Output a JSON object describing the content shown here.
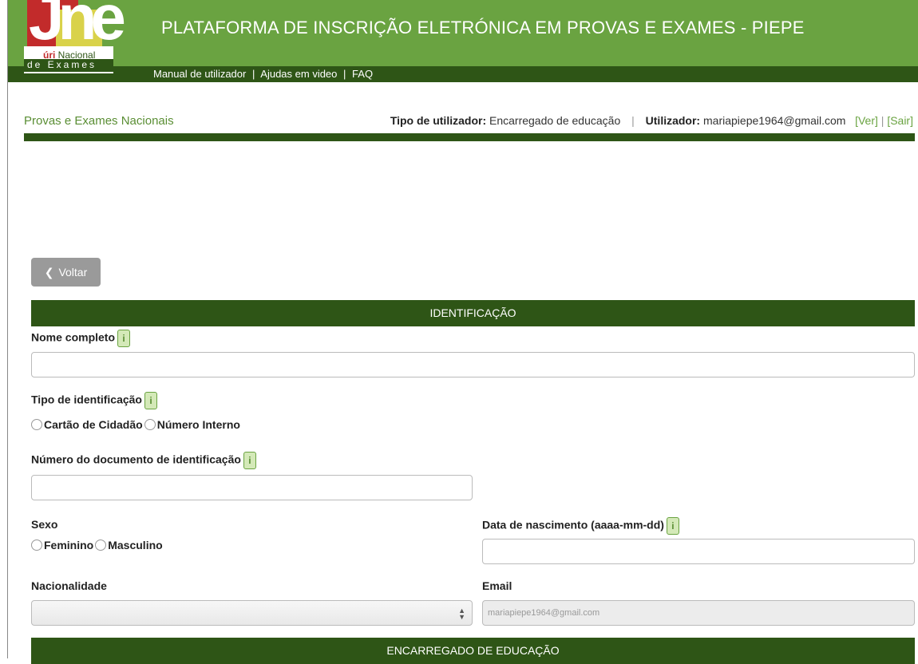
{
  "header": {
    "title": "PLATAFORMA DE INSCRIÇÃO ELETRÓNICA EM PROVAS E EXAMES - PIEPE",
    "nav": [
      "Manual de utilizador",
      "Ajudas em video",
      "FAQ"
    ],
    "logo": {
      "letters": "Jne",
      "line1_bold": "úri",
      "line1_rest": " Nacional",
      "line2": "de Exames"
    }
  },
  "infobar": {
    "section": "Provas e Exames Nacionais",
    "user_type_label": "Tipo de utilizador:",
    "user_type_value": "Encarregado de educação",
    "user_label": "Utilizador:",
    "user_value": "mariapiepe1964@gmail.com",
    "view_link": "[Ver]",
    "logout_link": "[Sair]"
  },
  "back_button": {
    "label": "Voltar"
  },
  "sections": {
    "identificacao": "IDENTIFICAÇÃO",
    "encarregado": "ENCARREGADO DE EDUCAÇÃO"
  },
  "form": {
    "info_icon": "i",
    "nome_completo": {
      "label": "Nome completo",
      "value": ""
    },
    "tipo_identificacao": {
      "label": "Tipo de identificação",
      "options": [
        "Cartão de Cidadão",
        "Número Interno"
      ]
    },
    "numero_documento": {
      "label": "Número do documento de identificação",
      "value": ""
    },
    "sexo": {
      "label": "Sexo",
      "options": [
        "Feminino",
        "Masculino"
      ]
    },
    "data_nascimento": {
      "label": "Data de nascimento (aaaa-mm-dd)",
      "value": ""
    },
    "nacionalidade": {
      "label": "Nacionalidade",
      "value": ""
    },
    "email": {
      "label": "Email",
      "value": "mariapiepe1964@gmail.com"
    }
  },
  "colors": {
    "header_green": "#6aa341",
    "dark_green": "#2e5516",
    "button_gray": "#9a9a9a"
  }
}
